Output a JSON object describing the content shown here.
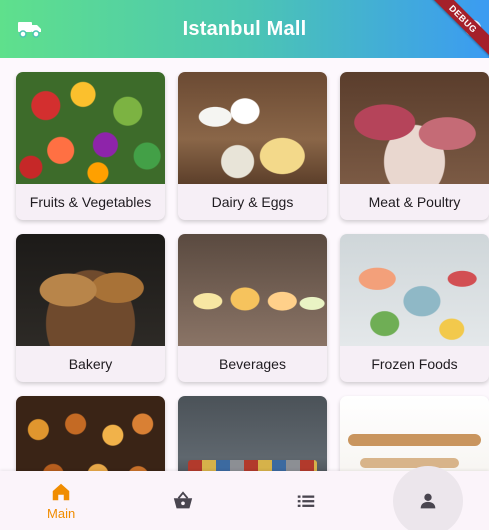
{
  "appbar": {
    "title": "Istanbul Mall",
    "debug_label": "DEBUG",
    "left_icon": "truck-icon",
    "right_icon": "gear-icon"
  },
  "categories": [
    {
      "label": "Fruits & Vegetables"
    },
    {
      "label": "Dairy & Eggs"
    },
    {
      "label": "Meat & Poultry"
    },
    {
      "label": "Bakery"
    },
    {
      "label": "Beverages"
    },
    {
      "label": "Frozen Foods"
    },
    {
      "label": ""
    },
    {
      "label": ""
    },
    {
      "label": ""
    }
  ],
  "bottom_nav": {
    "items": [
      {
        "label": "Main",
        "icon": "home-icon",
        "active": true
      },
      {
        "label": "",
        "icon": "basket-icon"
      },
      {
        "label": "",
        "icon": "list-icon"
      },
      {
        "label": "",
        "icon": "person-icon"
      }
    ],
    "active_color": "#F08C00",
    "inactive_color": "#49454F"
  },
  "colors": {
    "appbar_gradient_start": "#5FE08C",
    "appbar_gradient_end": "#3B9BF2",
    "debug_ribbon": "#A5202A",
    "card_bg": "#F6EFF6"
  }
}
